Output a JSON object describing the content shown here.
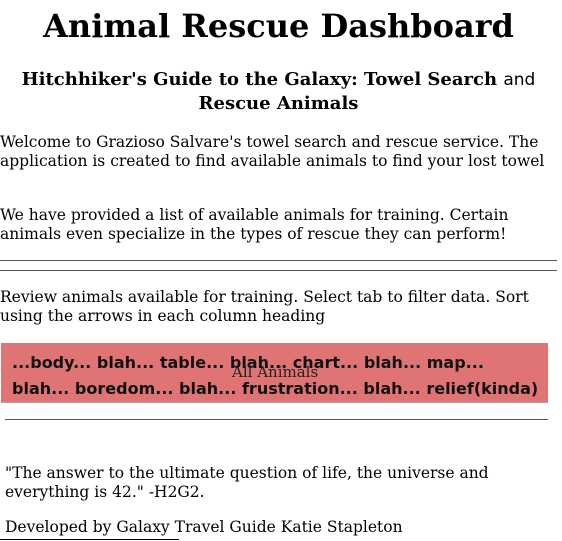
{
  "header": {
    "title": "Animal Rescue Dashboard",
    "subtitle_part1": "Hitchhiker's Guide to the Galaxy: Towel Search",
    "subtitle_part2": "and",
    "subtitle_part3": "Rescue Animals"
  },
  "intro": {
    "paragraph1": "Welcome to Grazioso Salvare's towel search and rescue service. The application is created to find available animals to find your lost towel",
    "paragraph2": "We have provided a list of available animals for training. Certain animals even specialize in the types of rescue they can perform!"
  },
  "instructions": "Review animals available for training. Select tab to filter data. Sort using the arrows in each column heading",
  "banner": {
    "line1": "...body... blah... table... blah... chart... blah... map...",
    "line2": "blah... boredom... blah... frustration... blah... relief(kinda)",
    "tab_label": "All Animals",
    "color": "#e07474"
  },
  "quote": "\"The answer to the ultimate question of life, the universe and everything is 42.\" -H2G2.",
  "footer": {
    "text": "Developed by Galaxy Travel Guide Katie Stapleton"
  }
}
